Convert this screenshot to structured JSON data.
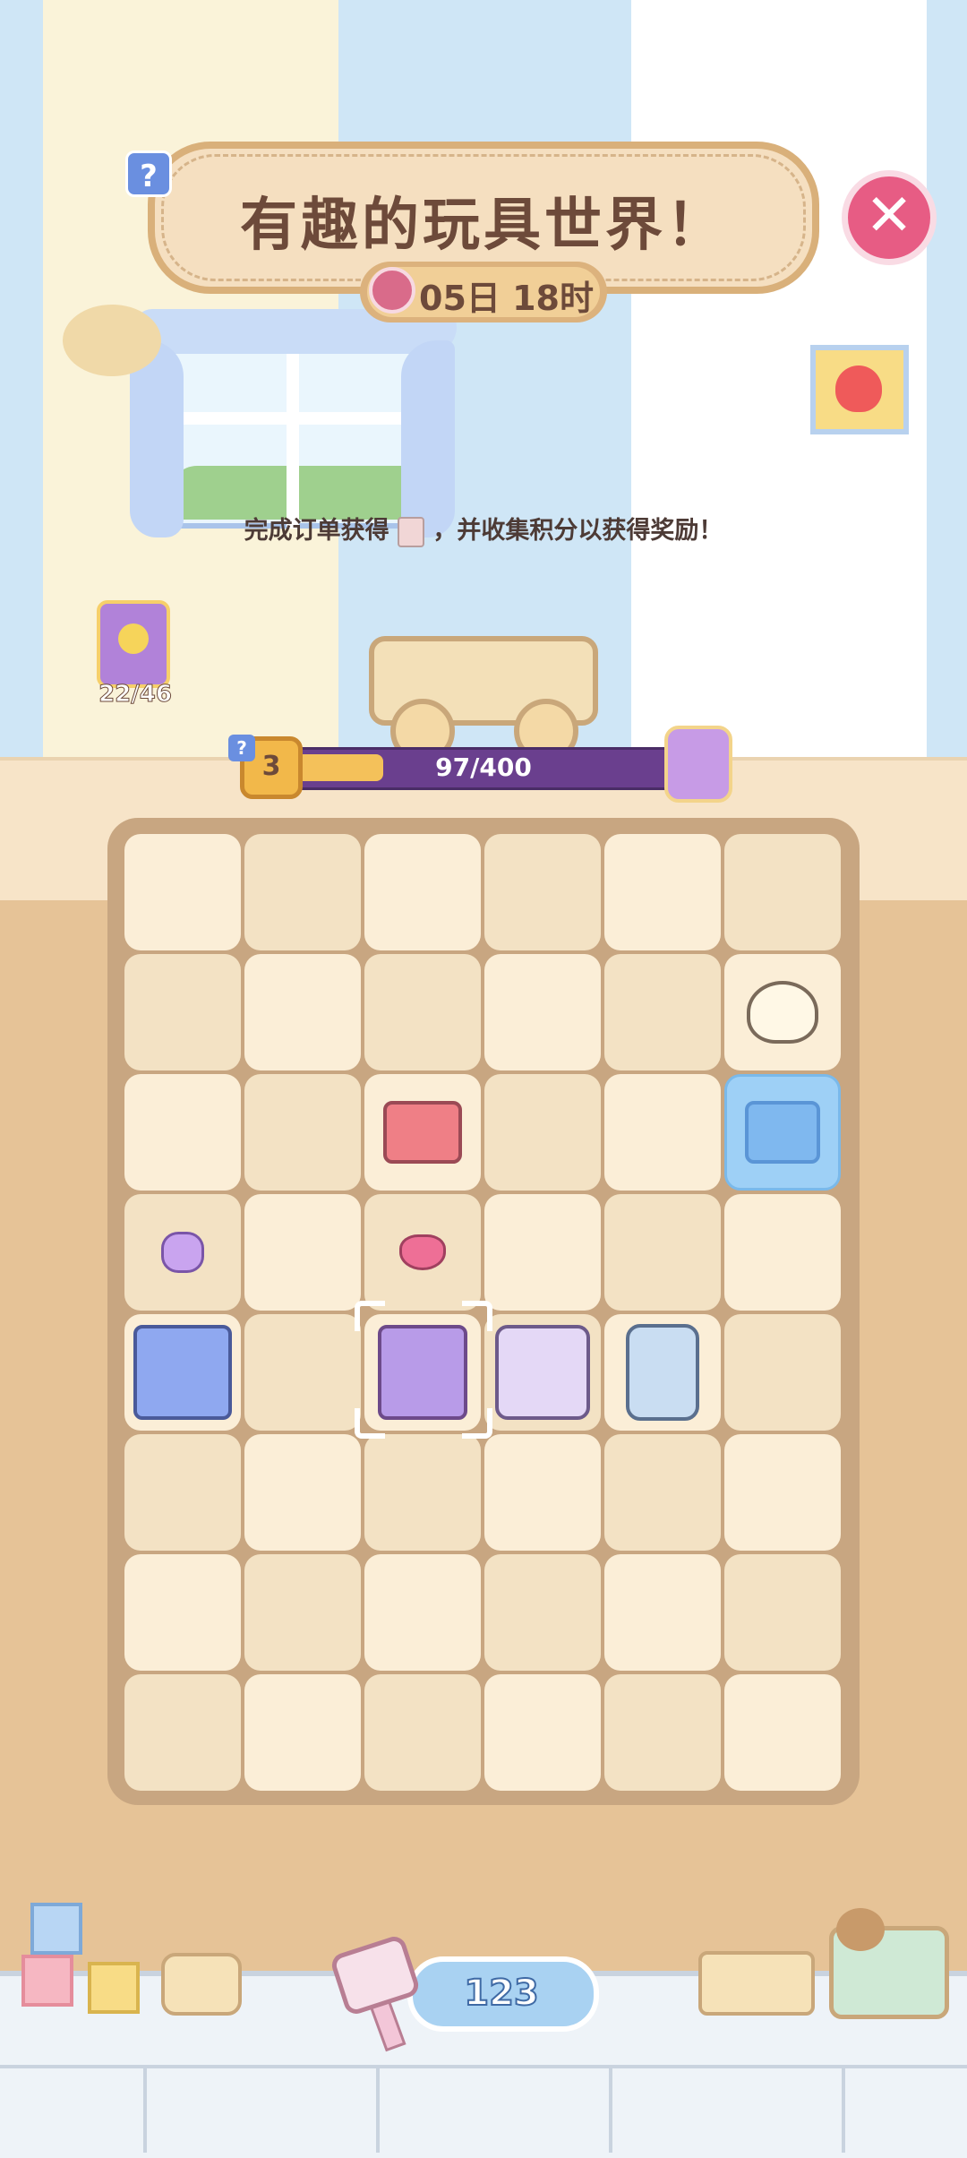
{
  "event": {
    "title": "有趣的玩具世界！",
    "timer": "05日 18时",
    "instruction_before": "完成订单获得",
    "instruction_after": "，并收集积分以获得奖励！"
  },
  "album": {
    "count": "22/46"
  },
  "progress": {
    "level": "3",
    "text": "97/400",
    "fraction": 0.2425
  },
  "board": {
    "rows": 8,
    "cols": 6,
    "items": [
      {
        "row": 1,
        "col": 5,
        "name": "rubber-duck"
      },
      {
        "row": 2,
        "col": 5,
        "name": "frozen-cart",
        "frozen": true
      },
      {
        "row": 2,
        "col": 2,
        "name": "red-lego-brick"
      },
      {
        "row": 3,
        "col": 0,
        "name": "purple-gem"
      },
      {
        "row": 3,
        "col": 2,
        "name": "pink-gem"
      },
      {
        "row": 4,
        "col": 0,
        "name": "lego-brick-stack"
      },
      {
        "row": 4,
        "col": 2,
        "name": "purple-brick-tower",
        "selected": true
      },
      {
        "row": 4,
        "col": 3,
        "name": "shape-sorter-cube"
      },
      {
        "row": 4,
        "col": 4,
        "name": "toy-robot"
      }
    ]
  },
  "currency": {
    "value": "123",
    "icon": "hammer-icon"
  },
  "colors": {
    "accent_close": "#e75c84",
    "progress_bar": "#6a3f8e",
    "progress_fill": "#f4c15a",
    "board": "#c8a681"
  }
}
